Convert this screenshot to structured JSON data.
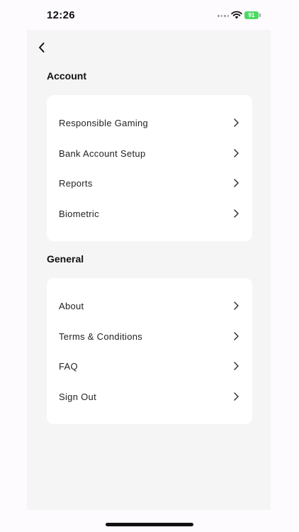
{
  "status_bar": {
    "time": "12:26",
    "battery": "91"
  },
  "nav": {
    "back_icon": "chevron-left-icon"
  },
  "sections": [
    {
      "title": "Account",
      "items": [
        {
          "label": "Responsible Gaming"
        },
        {
          "label": "Bank Account Setup"
        },
        {
          "label": "Reports"
        },
        {
          "label": "Biometric"
        }
      ]
    },
    {
      "title": "General",
      "items": [
        {
          "label": "About"
        },
        {
          "label": "Terms & Conditions"
        },
        {
          "label": "FAQ"
        },
        {
          "label": "Sign Out"
        }
      ]
    }
  ],
  "colors": {
    "page_background": "#f5f5f5",
    "card_background": "#ffffff",
    "battery_green": "#4cd964",
    "text": "#222222"
  }
}
